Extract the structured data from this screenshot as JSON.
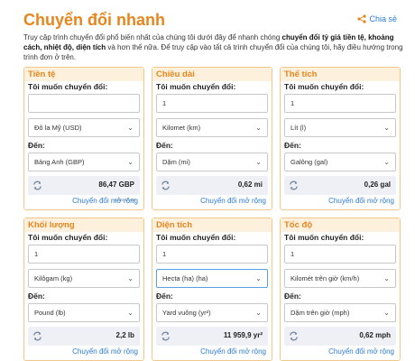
{
  "header": {
    "title": "Chuyển đổi nhanh",
    "share_label": "Chia sẻ"
  },
  "intro": {
    "p1": "Truy cập trình chuyển đổi phổ biến nhất của chúng tôi dưới đây để nhanh chóng ",
    "p2": "chuyển đổi tỷ giá tiền tệ, khoảng cách, nhiệt độ, diện tích",
    "p3": " và hơn thế nữa. Để truy cập vào tất cả trình chuyển đổi của chúng tôi, hãy điều hướng trong trình đơn ở trên."
  },
  "labels": {
    "from": "Tôi muốn chuyển đổi:",
    "to": "Đến:",
    "more": "Chuyển đổi mở rộng"
  },
  "cards": [
    {
      "title": "Tiền tệ",
      "amount": "",
      "from_unit": "Đô la Mỹ (USD)",
      "to_unit": "Bảng Anh (GBP)",
      "result": "86,47 GBP",
      "date": "2022-10-28"
    },
    {
      "title": "Chiều dài",
      "amount": "1",
      "from_unit": "Kilomet (km)",
      "to_unit": "Dặm (mi)",
      "result": "0,62 mi"
    },
    {
      "title": "Thể tích",
      "amount": "1",
      "from_unit": "Lít (l)",
      "to_unit": "Galông (gal)",
      "result": "0,26 gal"
    },
    {
      "title": "Khối lượng",
      "amount": "1",
      "from_unit": "Kilôgam (kg)",
      "to_unit": "Pound (lb)",
      "result": "2,2 lb"
    },
    {
      "title": "Diện tích",
      "amount": "1",
      "from_unit": "Hecta (ha) (ha)",
      "to_unit": "Yard vuông (yr²)",
      "result": "11 959,9 yr²"
    },
    {
      "title": "Tốc độ",
      "amount": "1",
      "from_unit": "Kilomét trên giờ (km/h)",
      "to_unit": "Dặm trên giờ (mph)",
      "result": "0,62 mph"
    }
  ],
  "colors": {
    "accent": "#e8851c",
    "link": "#2b7bd6",
    "card_header_bg": "#fdf0dc",
    "result_bg": "#eef0f5"
  },
  "icons": {
    "share": "share-icon",
    "swap": "refresh-arrows-icon",
    "dropdown": "chevron-down-icon"
  }
}
